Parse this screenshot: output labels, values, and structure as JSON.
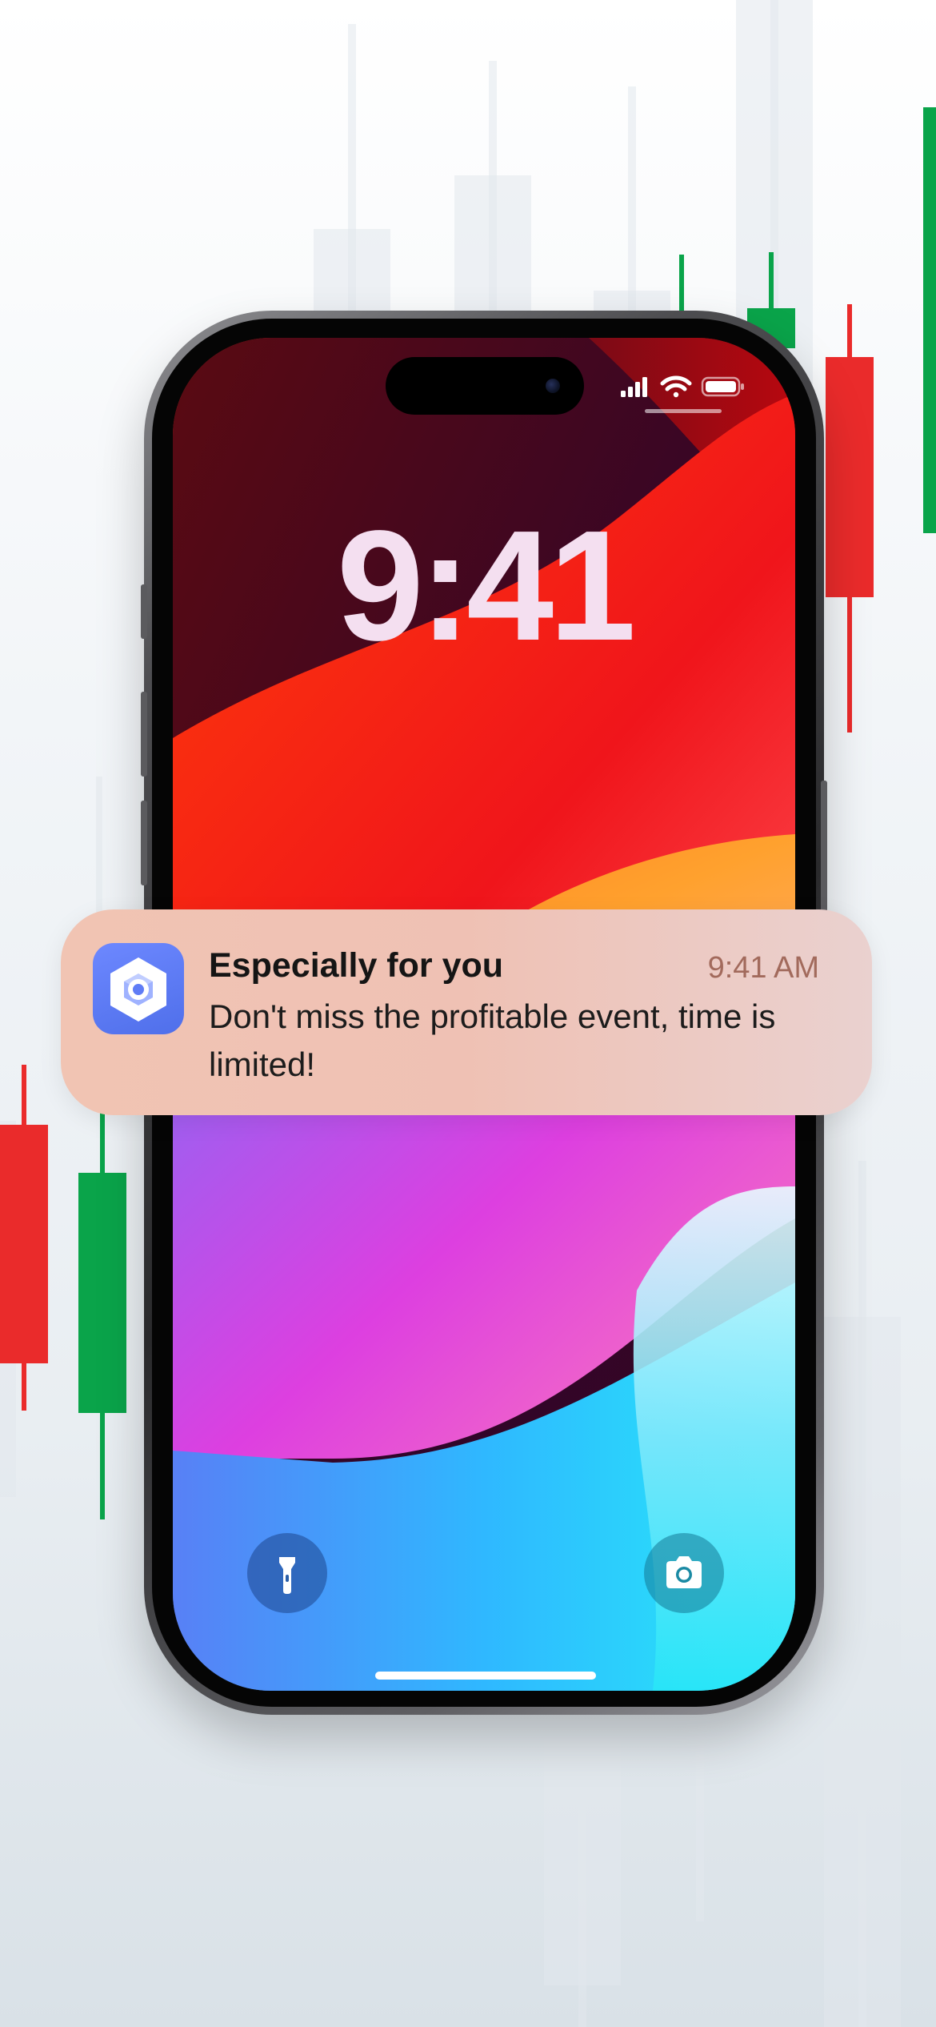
{
  "lock_screen": {
    "time": "9:41"
  },
  "status_bar": {
    "signal_icon": "cellular-signal-icon",
    "wifi_icon": "wifi-icon",
    "battery_icon": "battery-icon"
  },
  "notification": {
    "app_icon": "cube-app-icon",
    "title": "Especially for you",
    "time": "9:41 AM",
    "body": "Don't miss the profitable event, time is limited!"
  },
  "quick_actions": {
    "flashlight_icon": "flashlight-icon",
    "camera_icon": "camera-icon"
  },
  "colors": {
    "candle_up": "#0aa44a",
    "candle_down": "#ea2b2b",
    "icon_accent": "#5f7cf6"
  }
}
